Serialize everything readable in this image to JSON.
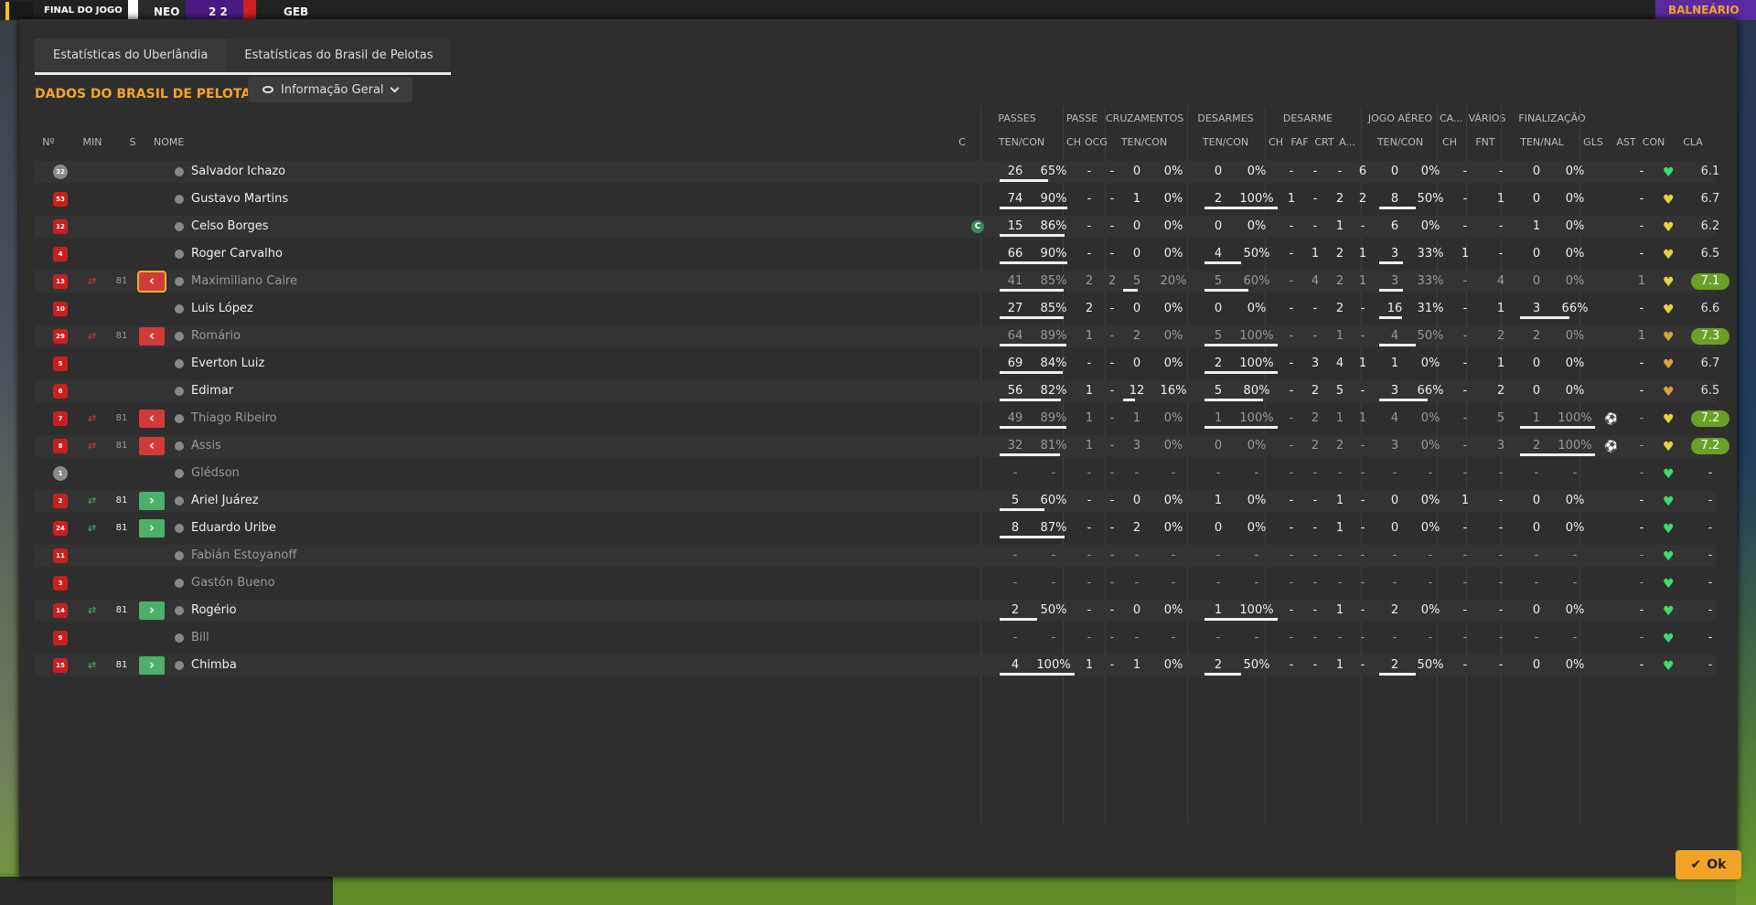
{
  "topbar": {
    "status": "FINAL DO JOGO",
    "home": "NEO",
    "score": "2 2",
    "away": "GEB",
    "right": "BALNEÁRIO"
  },
  "tabs": [
    "Estatísticas do Uberlândia",
    "Estatísticas do Brasil de Pelotas"
  ],
  "title": "DADOS DO BRASIL DE PELOTAS",
  "view_select": "Informação Geral",
  "groups": [
    "PASSES",
    "PASSE",
    "CRUZAMENTOS",
    "DESARMES",
    "DESARME",
    "JOGO AÉREO",
    "CA...",
    "VÁRIOS",
    "FINALIZAÇÃO"
  ],
  "headers": [
    "Nº",
    "MIN",
    "S",
    "NOME",
    "C",
    "TEN/CON",
    "CH",
    "OCG",
    "TEN/CON",
    "TEN/CON",
    "CH",
    "FAF",
    "CRT",
    "A...",
    "TEN/CON",
    "CH",
    "FNT",
    "TEN/NAL",
    "GLS",
    "AST",
    "CON",
    "CLA"
  ],
  "ok_label": "Ok",
  "colors": {
    "accent": "#f2a42a",
    "sub_off": "#d23a3a",
    "sub_on": "#4caf6a",
    "rating_high": "#6aa026"
  },
  "players": [
    {
      "num": "32",
      "gk": true,
      "min": "",
      "sub": "",
      "name": "Salvador Ichazo",
      "cap": "",
      "dim": false,
      "p": [
        "26",
        "65%"
      ],
      "pp": 0.65,
      "pch": "-",
      "pocg": "-",
      "cr": [
        "0",
        "0%"
      ],
      "crp": 0,
      "de": [
        "0",
        "0%"
      ],
      "dep": 0,
      "dch": "-",
      "faf": "-",
      "crt": "-",
      "a": "6",
      "ja": [
        "0",
        "0%"
      ],
      "jap": 0,
      "ca": "-",
      "fnt": "-",
      "fi": [
        "0",
        "0%"
      ],
      "fip": 0,
      "ball": false,
      "gls": "",
      "ast": "-",
      "con": "green",
      "cla": "6.1",
      "hi": false
    },
    {
      "num": "53",
      "gk": false,
      "min": "",
      "sub": "",
      "name": "Gustavo Martins",
      "cap": "",
      "dim": false,
      "p": [
        "74",
        "90%"
      ],
      "pp": 0.9,
      "pch": "-",
      "pocg": "-",
      "cr": [
        "1",
        "0%"
      ],
      "crp": 0,
      "de": [
        "2",
        "100%"
      ],
      "dep": 1,
      "dch": "1",
      "faf": "-",
      "crt": "2",
      "a": "2",
      "ja": [
        "8",
        "50%"
      ],
      "jap": 0.5,
      "ca": "-",
      "fnt": "1",
      "fi": [
        "0",
        "0%"
      ],
      "fip": 0,
      "ball": false,
      "gls": "",
      "ast": "-",
      "con": "yellow",
      "cla": "6.7",
      "hi": false
    },
    {
      "num": "12",
      "gk": false,
      "min": "",
      "sub": "",
      "name": "Celso Borges",
      "cap": "C",
      "dim": false,
      "p": [
        "15",
        "86%"
      ],
      "pp": 0.86,
      "pch": "-",
      "pocg": "-",
      "cr": [
        "0",
        "0%"
      ],
      "crp": 0,
      "de": [
        "0",
        "0%"
      ],
      "dep": 0,
      "dch": "-",
      "faf": "-",
      "crt": "1",
      "a": "-",
      "ja": [
        "6",
        "0%"
      ],
      "jap": 0,
      "ca": "-",
      "fnt": "-",
      "fi": [
        "1",
        "0%"
      ],
      "fip": 0,
      "ball": false,
      "gls": "",
      "ast": "-",
      "con": "yellow",
      "cla": "6.2",
      "hi": false
    },
    {
      "num": "4",
      "gk": false,
      "min": "",
      "sub": "",
      "name": "Roger Carvalho",
      "cap": "",
      "dim": false,
      "p": [
        "66",
        "90%"
      ],
      "pp": 0.9,
      "pch": "-",
      "pocg": "-",
      "cr": [
        "0",
        "0%"
      ],
      "crp": 0,
      "de": [
        "4",
        "50%"
      ],
      "dep": 0.5,
      "dch": "-",
      "faf": "1",
      "crt": "2",
      "a": "1",
      "ja": [
        "3",
        "33%"
      ],
      "jap": 0.33,
      "ca": "1",
      "fnt": "-",
      "fi": [
        "0",
        "0%"
      ],
      "fip": 0,
      "ball": false,
      "gls": "",
      "ast": "-",
      "con": "yellow",
      "cla": "6.5",
      "hi": false
    },
    {
      "num": "13",
      "gk": false,
      "min": "81",
      "sub": "off",
      "name": "Maximiliano Caire",
      "cap": "",
      "dim": true,
      "hl": true,
      "p": [
        "41",
        "85%"
      ],
      "pp": 0.85,
      "pch": "2",
      "pocg": "2",
      "cr": [
        "5",
        "20%"
      ],
      "crp": 0.2,
      "de": [
        "5",
        "60%"
      ],
      "dep": 0.6,
      "dch": "-",
      "faf": "4",
      "crt": "2",
      "a": "1",
      "ja": [
        "3",
        "33%"
      ],
      "jap": 0.33,
      "ca": "-",
      "fnt": "4",
      "fi": [
        "0",
        "0%"
      ],
      "fip": 0,
      "ball": false,
      "gls": "",
      "ast": "1",
      "con": "yellow",
      "cla": "7.1",
      "hi": true
    },
    {
      "num": "10",
      "gk": false,
      "min": "",
      "sub": "",
      "name": "Luis López",
      "cap": "",
      "dim": false,
      "p": [
        "27",
        "85%"
      ],
      "pp": 0.85,
      "pch": "2",
      "pocg": "-",
      "cr": [
        "0",
        "0%"
      ],
      "crp": 0,
      "de": [
        "0",
        "0%"
      ],
      "dep": 0,
      "dch": "-",
      "faf": "-",
      "crt": "2",
      "a": "-",
      "ja": [
        "16",
        "31%"
      ],
      "jap": 0.31,
      "ca": "-",
      "fnt": "1",
      "fi": [
        "3",
        "66%"
      ],
      "fip": 0.66,
      "ball": false,
      "gls": "",
      "ast": "-",
      "con": "yellow",
      "cla": "6.6",
      "hi": false
    },
    {
      "num": "29",
      "gk": false,
      "min": "81",
      "sub": "off",
      "name": "Romário",
      "cap": "",
      "dim": true,
      "p": [
        "64",
        "89%"
      ],
      "pp": 0.89,
      "pch": "1",
      "pocg": "-",
      "cr": [
        "2",
        "0%"
      ],
      "crp": 0,
      "de": [
        "5",
        "100%"
      ],
      "dep": 1,
      "dch": "-",
      "faf": "-",
      "crt": "1",
      "a": "-",
      "ja": [
        "4",
        "50%"
      ],
      "jap": 0.5,
      "ca": "-",
      "fnt": "2",
      "fi": [
        "2",
        "0%"
      ],
      "fip": 0,
      "ball": false,
      "gls": "",
      "ast": "1",
      "con": "orange",
      "cla": "7.3",
      "hi": true
    },
    {
      "num": "5",
      "gk": false,
      "min": "",
      "sub": "",
      "name": "Everton Luiz",
      "cap": "",
      "dim": false,
      "p": [
        "69",
        "84%"
      ],
      "pp": 0.84,
      "pch": "-",
      "pocg": "-",
      "cr": [
        "0",
        "0%"
      ],
      "crp": 0,
      "de": [
        "2",
        "100%"
      ],
      "dep": 1,
      "dch": "-",
      "faf": "3",
      "crt": "4",
      "a": "1",
      "ja": [
        "1",
        "0%"
      ],
      "jap": 0,
      "ca": "-",
      "fnt": "1",
      "fi": [
        "0",
        "0%"
      ],
      "fip": 0,
      "ball": false,
      "gls": "",
      "ast": "-",
      "con": "orange",
      "cla": "6.7",
      "hi": false
    },
    {
      "num": "6",
      "gk": false,
      "min": "",
      "sub": "",
      "name": "Edimar",
      "cap": "",
      "dim": false,
      "p": [
        "56",
        "82%"
      ],
      "pp": 0.82,
      "pch": "1",
      "pocg": "-",
      "cr": [
        "12",
        "16%"
      ],
      "crp": 0.16,
      "de": [
        "5",
        "80%"
      ],
      "dep": 0.8,
      "dch": "-",
      "faf": "2",
      "crt": "5",
      "a": "-",
      "ja": [
        "3",
        "66%"
      ],
      "jap": 0.66,
      "ca": "-",
      "fnt": "2",
      "fi": [
        "0",
        "0%"
      ],
      "fip": 0,
      "ball": false,
      "gls": "",
      "ast": "-",
      "con": "orange",
      "cla": "6.5",
      "hi": false
    },
    {
      "num": "7",
      "gk": false,
      "min": "81",
      "sub": "off",
      "name": "Thiago Ribeiro",
      "cap": "",
      "dim": true,
      "p": [
        "49",
        "89%"
      ],
      "pp": 0.89,
      "pch": "1",
      "pocg": "-",
      "cr": [
        "1",
        "0%"
      ],
      "crp": 0,
      "de": [
        "1",
        "100%"
      ],
      "dep": 1,
      "dch": "-",
      "faf": "2",
      "crt": "1",
      "a": "1",
      "ja": [
        "4",
        "0%"
      ],
      "jap": 0,
      "ca": "-",
      "fnt": "5",
      "fi": [
        "1",
        "100%"
      ],
      "fip": 1,
      "ball": true,
      "gls": "",
      "ast": "-",
      "con": "yellow",
      "cla": "7.2",
      "hi": true
    },
    {
      "num": "8",
      "gk": false,
      "min": "81",
      "sub": "off",
      "name": "Assis",
      "cap": "",
      "dim": true,
      "p": [
        "32",
        "81%"
      ],
      "pp": 0.81,
      "pch": "1",
      "pocg": "-",
      "cr": [
        "3",
        "0%"
      ],
      "crp": 0,
      "de": [
        "0",
        "0%"
      ],
      "dep": 0,
      "dch": "-",
      "faf": "2",
      "crt": "2",
      "a": "-",
      "ja": [
        "3",
        "0%"
      ],
      "jap": 0,
      "ca": "-",
      "fnt": "3",
      "fi": [
        "2",
        "100%"
      ],
      "fip": 1,
      "ball": true,
      "gls": "",
      "ast": "-",
      "con": "yellow",
      "cla": "7.2",
      "hi": true
    },
    {
      "num": "1",
      "gk": true,
      "min": "",
      "sub": "",
      "name": "Glédson",
      "cap": "",
      "dim": true,
      "p": [
        "-",
        "-"
      ],
      "pp": 0,
      "pch": "-",
      "pocg": "-",
      "cr": [
        "-",
        "-"
      ],
      "crp": 0,
      "de": [
        "-",
        "-"
      ],
      "dep": 0,
      "dch": "-",
      "faf": "-",
      "crt": "-",
      "a": "-",
      "ja": [
        "-",
        "-"
      ],
      "jap": 0,
      "ca": "-",
      "fnt": "-",
      "fi": [
        "-",
        "-"
      ],
      "fip": 0,
      "ball": false,
      "gls": "",
      "ast": "-",
      "con": "green",
      "cla": "-",
      "hi": false
    },
    {
      "num": "2",
      "gk": false,
      "min": "81",
      "sub": "on",
      "name": "Ariel Juárez",
      "cap": "",
      "dim": false,
      "p": [
        "5",
        "60%"
      ],
      "pp": 0.6,
      "pch": "-",
      "pocg": "-",
      "cr": [
        "0",
        "0%"
      ],
      "crp": 0,
      "de": [
        "1",
        "0%"
      ],
      "dep": 0,
      "dch": "-",
      "faf": "-",
      "crt": "1",
      "a": "-",
      "ja": [
        "0",
        "0%"
      ],
      "jap": 0,
      "ca": "1",
      "fnt": "-",
      "fi": [
        "0",
        "0%"
      ],
      "fip": 0,
      "ball": false,
      "gls": "",
      "ast": "-",
      "con": "green",
      "cla": "-",
      "hi": false
    },
    {
      "num": "24",
      "gk": false,
      "min": "81",
      "sub": "on",
      "name": "Eduardo Uribe",
      "cap": "",
      "dim": false,
      "p": [
        "8",
        "87%"
      ],
      "pp": 0.87,
      "pch": "-",
      "pocg": "-",
      "cr": [
        "2",
        "0%"
      ],
      "crp": 0,
      "de": [
        "0",
        "0%"
      ],
      "dep": 0,
      "dch": "-",
      "faf": "-",
      "crt": "1",
      "a": "-",
      "ja": [
        "0",
        "0%"
      ],
      "jap": 0,
      "ca": "-",
      "fnt": "-",
      "fi": [
        "0",
        "0%"
      ],
      "fip": 0,
      "ball": false,
      "gls": "",
      "ast": "-",
      "con": "green",
      "cla": "-",
      "hi": false
    },
    {
      "num": "11",
      "gk": false,
      "min": "",
      "sub": "",
      "name": "Fabián Estoyanoff",
      "cap": "",
      "dim": true,
      "p": [
        "-",
        "-"
      ],
      "pp": 0,
      "pch": "-",
      "pocg": "-",
      "cr": [
        "-",
        "-"
      ],
      "crp": 0,
      "de": [
        "-",
        "-"
      ],
      "dep": 0,
      "dch": "-",
      "faf": "-",
      "crt": "-",
      "a": "-",
      "ja": [
        "-",
        "-"
      ],
      "jap": 0,
      "ca": "-",
      "fnt": "-",
      "fi": [
        "-",
        "-"
      ],
      "fip": 0,
      "ball": false,
      "gls": "",
      "ast": "-",
      "con": "green",
      "cla": "-",
      "hi": false
    },
    {
      "num": "3",
      "gk": false,
      "min": "",
      "sub": "",
      "name": "Gastón Bueno",
      "cap": "",
      "dim": true,
      "p": [
        "-",
        "-"
      ],
      "pp": 0,
      "pch": "-",
      "pocg": "-",
      "cr": [
        "-",
        "-"
      ],
      "crp": 0,
      "de": [
        "-",
        "-"
      ],
      "dep": 0,
      "dch": "-",
      "faf": "-",
      "crt": "-",
      "a": "-",
      "ja": [
        "-",
        "-"
      ],
      "jap": 0,
      "ca": "-",
      "fnt": "-",
      "fi": [
        "-",
        "-"
      ],
      "fip": 0,
      "ball": false,
      "gls": "",
      "ast": "-",
      "con": "green",
      "cla": "-",
      "hi": false
    },
    {
      "num": "14",
      "gk": false,
      "min": "81",
      "sub": "on",
      "name": "Rogério",
      "cap": "",
      "dim": false,
      "p": [
        "2",
        "50%"
      ],
      "pp": 0.5,
      "pch": "-",
      "pocg": "-",
      "cr": [
        "0",
        "0%"
      ],
      "crp": 0,
      "de": [
        "1",
        "100%"
      ],
      "dep": 1,
      "dch": "-",
      "faf": "-",
      "crt": "1",
      "a": "-",
      "ja": [
        "2",
        "0%"
      ],
      "jap": 0,
      "ca": "-",
      "fnt": "-",
      "fi": [
        "0",
        "0%"
      ],
      "fip": 0,
      "ball": false,
      "gls": "",
      "ast": "-",
      "con": "green",
      "cla": "-",
      "hi": false
    },
    {
      "num": "9",
      "gk": false,
      "min": "",
      "sub": "",
      "name": "Bill",
      "cap": "",
      "dim": true,
      "p": [
        "-",
        "-"
      ],
      "pp": 0,
      "pch": "-",
      "pocg": "-",
      "cr": [
        "-",
        "-"
      ],
      "crp": 0,
      "de": [
        "-",
        "-"
      ],
      "dep": 0,
      "dch": "-",
      "faf": "-",
      "crt": "-",
      "a": "-",
      "ja": [
        "-",
        "-"
      ],
      "jap": 0,
      "ca": "-",
      "fnt": "-",
      "fi": [
        "-",
        "-"
      ],
      "fip": 0,
      "ball": false,
      "gls": "",
      "ast": "-",
      "con": "green",
      "cla": "-",
      "hi": false
    },
    {
      "num": "15",
      "gk": false,
      "min": "81",
      "sub": "on",
      "name": "Chimba",
      "cap": "",
      "dim": false,
      "p": [
        "4",
        "100%"
      ],
      "pp": 1,
      "pch": "1",
      "pocg": "-",
      "cr": [
        "1",
        "0%"
      ],
      "crp": 0,
      "de": [
        "2",
        "50%"
      ],
      "dep": 0.5,
      "dch": "-",
      "faf": "-",
      "crt": "1",
      "a": "-",
      "ja": [
        "2",
        "50%"
      ],
      "jap": 0.5,
      "ca": "-",
      "fnt": "-",
      "fi": [
        "0",
        "0%"
      ],
      "fip": 0,
      "ball": false,
      "gls": "",
      "ast": "-",
      "con": "green",
      "cla": "-",
      "hi": false
    }
  ]
}
